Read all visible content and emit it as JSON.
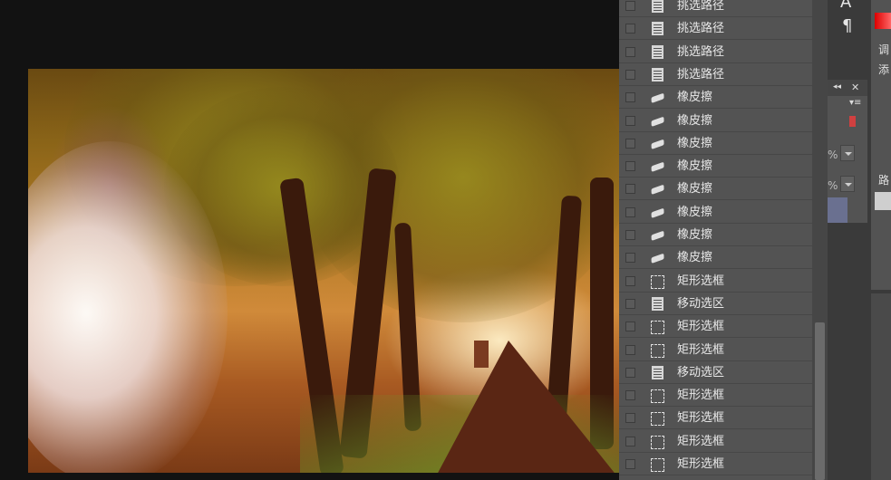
{
  "history": {
    "items": [
      {
        "label": "挑选路径",
        "icon": "document-icon"
      },
      {
        "label": "挑选路径",
        "icon": "document-icon"
      },
      {
        "label": "挑选路径",
        "icon": "document-icon"
      },
      {
        "label": "挑选路径",
        "icon": "document-icon"
      },
      {
        "label": "橡皮擦",
        "icon": "eraser-icon"
      },
      {
        "label": "橡皮擦",
        "icon": "eraser-icon"
      },
      {
        "label": "橡皮擦",
        "icon": "eraser-icon"
      },
      {
        "label": "橡皮擦",
        "icon": "eraser-icon"
      },
      {
        "label": "橡皮擦",
        "icon": "eraser-icon"
      },
      {
        "label": "橡皮擦",
        "icon": "eraser-icon"
      },
      {
        "label": "橡皮擦",
        "icon": "eraser-icon"
      },
      {
        "label": "橡皮擦",
        "icon": "eraser-icon"
      },
      {
        "label": "矩形选框",
        "icon": "rect-marquee-icon"
      },
      {
        "label": "移动选区",
        "icon": "document-icon"
      },
      {
        "label": "矩形选框",
        "icon": "rect-marquee-icon"
      },
      {
        "label": "矩形选框",
        "icon": "rect-marquee-icon"
      },
      {
        "label": "移动选区",
        "icon": "document-icon"
      },
      {
        "label": "矩形选框",
        "icon": "rect-marquee-icon"
      },
      {
        "label": "矩形选框",
        "icon": "rect-marquee-icon"
      },
      {
        "label": "矩形选框",
        "icon": "rect-marquee-icon"
      },
      {
        "label": "矩形选框",
        "icon": "rect-marquee-icon"
      }
    ]
  },
  "right_strip": {
    "tab_adjust": "调",
    "tab_add": "添",
    "tab_paths": "路",
    "pct_1": "%",
    "pct_2": "%",
    "accent_color": "#d04040"
  },
  "colors": {
    "panel_bg": "#535353",
    "canvas_bg": "#121212"
  }
}
